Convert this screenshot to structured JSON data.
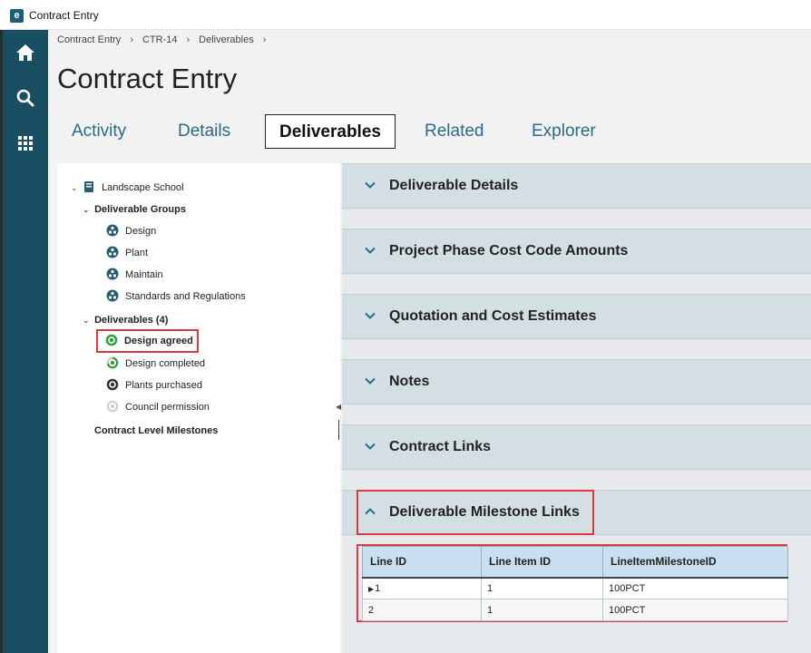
{
  "window": {
    "title": "Contract Entry",
    "app_icon_letter": "e"
  },
  "sidenav": {
    "items": [
      {
        "icon": "home-icon"
      },
      {
        "icon": "search-icon"
      },
      {
        "icon": "apps-grid-icon"
      }
    ]
  },
  "breadcrumb": [
    "Contract Entry",
    "CTR-14",
    "Deliverables"
  ],
  "breadcrumb_sep": "›",
  "page_title": "Contract Entry",
  "tabs": [
    "Activity",
    "Details",
    "Deliverables",
    "Related",
    "Explorer"
  ],
  "active_tab": "Deliverables",
  "tree": {
    "root": "Landscape School",
    "groups_label": "Deliverable Groups",
    "groups": [
      "Design",
      "Plant",
      "Maintain",
      "Standards and Regulations"
    ],
    "deliverables_label": "Deliverables (4)",
    "deliverables": [
      "Design agreed",
      "Design completed",
      "Plants purchased",
      "Council permission"
    ],
    "milestones_label": "Contract Level Milestones",
    "selected": "Design agreed"
  },
  "sections": [
    "Deliverable Details",
    "Project Phase Cost Code Amounts",
    "Quotation and Cost Estimates",
    "Notes",
    "Contract Links",
    "Deliverable Milestone Links"
  ],
  "milestone_grid": {
    "columns": [
      "Line ID",
      "Line Item ID",
      "LineItemMilestoneID"
    ],
    "rows": [
      [
        "1",
        "1",
        "100PCT"
      ],
      [
        "2",
        "1",
        "100PCT"
      ]
    ]
  },
  "colors": {
    "sidenav": "#1a4f63",
    "accent": "#2d6a8a",
    "highlight": "#e0383e"
  }
}
